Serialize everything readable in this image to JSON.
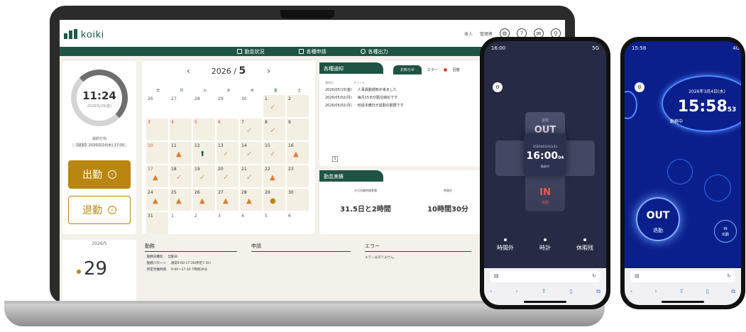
{
  "app": {
    "logo_text": "koiki",
    "header_right": [
      "本人",
      "管理者"
    ]
  },
  "nav": [
    "勤怠状況",
    "各種申請",
    "各種出力"
  ],
  "clock": {
    "time": "11:24",
    "date": "2026/5/29(金)",
    "status_label": "最終打刻",
    "status_value": "【退勤】2026/5/14(木) 17:00",
    "clock_in_label": "出勤",
    "clock_out_label": "退勤"
  },
  "calendar": {
    "year": "2026",
    "month": "5",
    "weekdays": [
      "日",
      "月",
      "火",
      "水",
      "木",
      "金",
      "土"
    ],
    "days": [
      {
        "d": "26",
        "out": true,
        "red": false,
        "mark": ""
      },
      {
        "d": "27",
        "out": true,
        "red": false,
        "mark": ""
      },
      {
        "d": "28",
        "out": true,
        "red": false,
        "mark": ""
      },
      {
        "d": "29",
        "out": true,
        "red": false,
        "mark": ""
      },
      {
        "d": "30",
        "out": true,
        "red": false,
        "mark": ""
      },
      {
        "d": "1",
        "out": false,
        "red": false,
        "mark": "check"
      },
      {
        "d": "2",
        "out": false,
        "red": false,
        "mark": ""
      },
      {
        "d": "3",
        "out": false,
        "red": true,
        "mark": ""
      },
      {
        "d": "4",
        "out": false,
        "red": true,
        "mark": ""
      },
      {
        "d": "5",
        "out": false,
        "red": true,
        "mark": ""
      },
      {
        "d": "6",
        "out": false,
        "red": true,
        "mark": ""
      },
      {
        "d": "7",
        "out": false,
        "red": false,
        "mark": "check"
      },
      {
        "d": "8",
        "out": false,
        "red": false,
        "mark": "check"
      },
      {
        "d": "9",
        "out": false,
        "red": false,
        "mark": ""
      },
      {
        "d": "10",
        "out": false,
        "red": true,
        "mark": ""
      },
      {
        "d": "11",
        "out": false,
        "red": false,
        "mark": "warn"
      },
      {
        "d": "12",
        "out": false,
        "red": false,
        "mark": "up"
      },
      {
        "d": "13",
        "out": false,
        "red": false,
        "mark": "check"
      },
      {
        "d": "14",
        "out": false,
        "red": false,
        "mark": "check"
      },
      {
        "d": "15",
        "out": false,
        "red": false,
        "mark": "check"
      },
      {
        "d": "16",
        "out": false,
        "red": false,
        "mark": "warn"
      },
      {
        "d": "17",
        "out": false,
        "red": true,
        "mark": "warn"
      },
      {
        "d": "18",
        "out": false,
        "red": false,
        "mark": "check"
      },
      {
        "d": "19",
        "out": false,
        "red": false,
        "mark": "check"
      },
      {
        "d": "20",
        "out": false,
        "red": false,
        "mark": "check"
      },
      {
        "d": "21",
        "out": false,
        "red": false,
        "mark": "check"
      },
      {
        "d": "22",
        "out": false,
        "red": false,
        "mark": "warn"
      },
      {
        "d": "23",
        "out": false,
        "red": false,
        "mark": ""
      },
      {
        "d": "24",
        "out": false,
        "red": false,
        "mark": "warn"
      },
      {
        "d": "25",
        "out": false,
        "red": false,
        "mark": "warn"
      },
      {
        "d": "26",
        "out": false,
        "red": false,
        "mark": "warn"
      },
      {
        "d": "27",
        "out": false,
        "red": false,
        "mark": "warn"
      },
      {
        "d": "28",
        "out": false,
        "red": false,
        "mark": "warn"
      },
      {
        "d": "29",
        "out": false,
        "red": false,
        "mark": "badge"
      },
      {
        "d": "30",
        "out": false,
        "red": false,
        "mark": ""
      },
      {
        "d": "31",
        "out": false,
        "red": false,
        "mark": ""
      },
      {
        "d": "1",
        "out": true,
        "red": false,
        "mark": ""
      },
      {
        "d": "2",
        "out": true,
        "red": false,
        "mark": ""
      },
      {
        "d": "3",
        "out": true,
        "red": false,
        "mark": ""
      },
      {
        "d": "4",
        "out": true,
        "red": false,
        "mark": ""
      },
      {
        "d": "5",
        "out": true,
        "red": false,
        "mark": ""
      },
      {
        "d": "6",
        "out": true,
        "red": false,
        "mark": ""
      }
    ]
  },
  "notices": {
    "title": "各種通知",
    "tabs": [
      "お知らせ",
      "エラー",
      "回答"
    ],
    "col_date": "通知日",
    "col_title": "タイトル",
    "rows": [
      {
        "date": "2026/05/15(金)",
        "title": "人事異動通知が来ました"
      },
      {
        "date": "2026/05/02(月)",
        "title": "毎月15日が勤怠締めです"
      },
      {
        "date": "2026/05/02(月)",
        "title": "他退本備日が退勤の期限です"
      }
    ],
    "page": "1"
  },
  "attendance": {
    "title": "勤怠実績",
    "col1_label": "今月労働時間累積",
    "col1_value": "31.5日と2時間",
    "col2_label": "時間外",
    "col2_value": "10時間30分"
  },
  "bottom": {
    "month": "2026/5",
    "day": "29",
    "work_title": "勤務",
    "request_title": "申請",
    "error_title": "エラー",
    "error_text": "エラーはありません。",
    "work_rows": [
      {
        "k": "勤務日種別",
        "v": "出勤日"
      },
      {
        "k": "勤務パターン",
        "v": "通常9:00-17:30(所定7.5h)"
      },
      {
        "k": "所定労働時間",
        "v": "9:00〜17:30 7時間30分"
      }
    ]
  },
  "phone1": {
    "status_time": "16:00",
    "status_right": "5G",
    "out_label": "退勤",
    "out_en": "OUT",
    "date": "2026年6月4日(木)",
    "time": "16:00",
    "seconds": "04",
    "state": "勤務中",
    "in_en": "IN",
    "in_label": "出勤",
    "tabs": [
      "時間外",
      "時計",
      "休暇残"
    ],
    "url_icon": "book-icon"
  },
  "phone2": {
    "status_time": "15:58",
    "status_right": "4G",
    "date": "2026年3月4日(水)",
    "time": "15:58",
    "seconds": "53",
    "state": "勤務中",
    "out_en": "OUT",
    "out_label": "退勤",
    "in_en": "IN",
    "in_label": "出勤"
  }
}
